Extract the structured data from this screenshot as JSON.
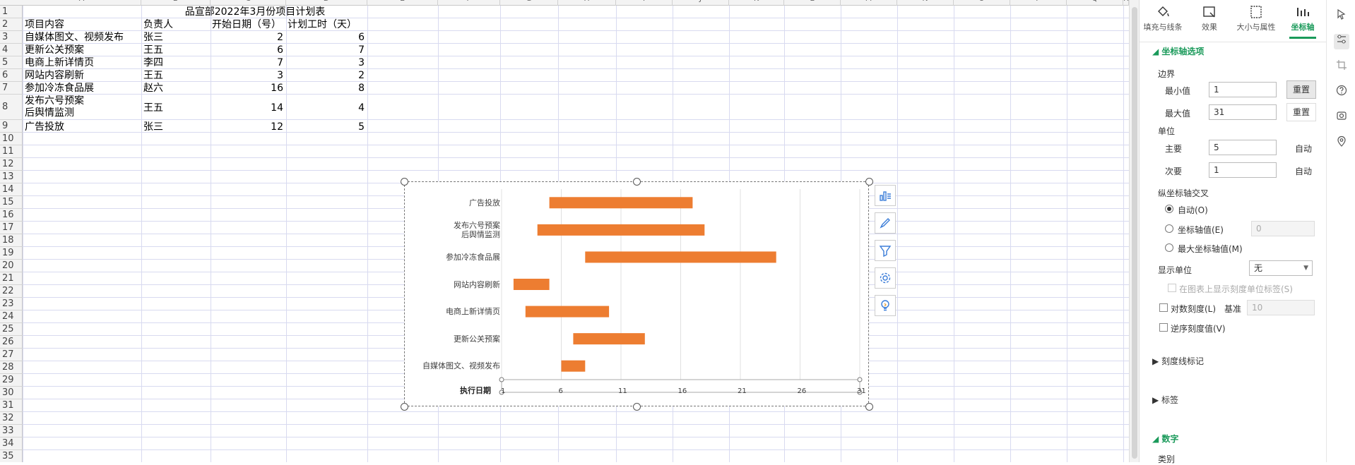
{
  "column_headers": [
    "A",
    "B",
    "C",
    "D",
    "E",
    "F",
    "G",
    "H",
    "I",
    "J",
    "K",
    "L",
    "M",
    "N",
    "O",
    "P",
    "Q",
    "R"
  ],
  "row_numbers": [
    "1",
    "2",
    "3",
    "4",
    "5",
    "6",
    "7",
    "8",
    "9",
    "10",
    "11",
    "12",
    "13",
    "14",
    "15",
    "16",
    "17",
    "18",
    "19",
    "20",
    "21",
    "22",
    "23",
    "24",
    "25",
    "26",
    "27",
    "28",
    "29",
    "30",
    "31",
    "32",
    "33",
    "34",
    "35"
  ],
  "table": {
    "title": "品宣部2022年3月份项目计划表",
    "headers": [
      "项目内容",
      "负责人",
      "开始日期（号）",
      "计划工时（天）"
    ],
    "rows": [
      {
        "task": "自媒体图文、视频发布",
        "owner": "张三",
        "start": "2",
        "days": "6"
      },
      {
        "task": "更新公关预案",
        "owner": "王五",
        "start": "6",
        "days": "7"
      },
      {
        "task": "电商上新详情页",
        "owner": "李四",
        "start": "7",
        "days": "3"
      },
      {
        "task": "网站内容刷新",
        "owner": "王五",
        "start": "3",
        "days": "2"
      },
      {
        "task": "参加冷冻食品展",
        "owner": "赵六",
        "start": "16",
        "days": "8"
      },
      {
        "task": "发布六号预案",
        "task2": "后舆情监测",
        "owner": "王五",
        "start": "14",
        "days": "4"
      },
      {
        "task": "广告投放",
        "owner": "张三",
        "start": "12",
        "days": "5"
      }
    ]
  },
  "chart_data": {
    "type": "bar",
    "orientation": "horizontal-gantt",
    "categories": [
      "广告投放",
      "发布六号预案\n后舆情监测",
      "参加冷冻食品展",
      "网站内容刷新",
      "电商上新详情页",
      "更新公关预案",
      "自媒体图文、视频发布"
    ],
    "series": [
      {
        "name": "",
        "start": [
          5,
          4,
          8,
          2,
          3,
          7,
          6
        ],
        "duration": [
          12,
          14,
          16,
          3,
          7,
          6,
          2
        ],
        "color": "#ed7d31"
      }
    ],
    "xlabel": "执行日期",
    "xlim": [
      1,
      31
    ],
    "xticks": [
      "1",
      "6",
      "11",
      "16",
      "21",
      "26",
      "31"
    ],
    "grid": true
  },
  "chart_tools": [
    "chart-elements-icon",
    "chart-style-brush-icon",
    "chart-filter-icon",
    "chart-settings-gear-icon",
    "chart-ideas-bulb-icon"
  ],
  "panel": {
    "tabs": [
      {
        "label": "填充与线条",
        "icon": "fill-bucket-icon"
      },
      {
        "label": "效果",
        "icon": "effects-icon"
      },
      {
        "label": "大小与属性",
        "icon": "size-properties-icon"
      },
      {
        "label": "坐标轴",
        "icon": "axis-options-icon"
      }
    ],
    "axis_options_title": "坐标轴选项",
    "bounds_label": "边界",
    "min_label": "最小值",
    "min_value": "1",
    "reset_label": "重置",
    "max_label": "最大值",
    "max_value": "31",
    "units_label": "单位",
    "major_label": "主要",
    "major_value": "5",
    "auto_label": "自动",
    "minor_label": "次要",
    "minor_value": "1",
    "cross_label": "纵坐标轴交叉",
    "cross_auto": "自动(O)",
    "cross_value": "坐标轴值(E)",
    "cross_value_input": "0",
    "cross_max": "最大坐标轴值(M)",
    "display_units_label": "显示单位",
    "display_units_value": "无",
    "show_units_label": "在图表上显示刻度单位标签(S)",
    "log_scale_label": "对数刻度(L)",
    "base_label": "基准",
    "base_value": "10",
    "reverse_label": "逆序刻度值(V)",
    "tick_marks_label": "刻度线标记",
    "labels_label": "标签",
    "number_label": "数字",
    "category_label": "类别"
  }
}
